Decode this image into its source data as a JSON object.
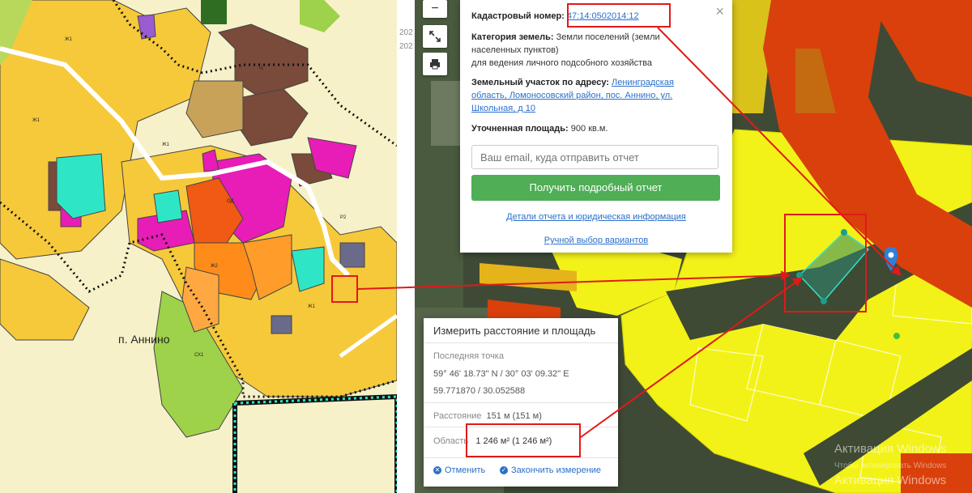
{
  "left_map": {
    "settlement_label": "п. Аннино"
  },
  "right_map": {
    "year_tabs": [
      "202",
      "202"
    ],
    "controls": {
      "zoom_out": "−",
      "fullscreen_icon": "expand-icon",
      "print_icon": "printer-icon"
    }
  },
  "info_popup": {
    "close": "×",
    "cadastral_label": "Кадастровый номер:",
    "cadastral_value": "47:14:0502014:12",
    "category_label": "Категория земель:",
    "category_value": "Земли поселений (земли населенных пунктов)",
    "usage_value": "для ведения личного подсобного хозяйства",
    "address_label": "Земельный участок по адресу:",
    "address_value": "Ленинградская область, Ломоносовский район, пос. Аннино, ул. Школьная, д 10",
    "area_label": "Уточненная площадь:",
    "area_value": "900 кв.м.",
    "email_placeholder": "Ваш email, куда отправить отчет",
    "report_button": "Получить подробный отчет",
    "details_link": "Детали отчета и юридическая информация",
    "manual_link": "Ручной выбор вариантов"
  },
  "measure_popup": {
    "title": "Измерить расстояние и площадь",
    "last_point_label": "Последняя точка",
    "coords_dms": "59° 46' 18.73\" N / 30° 03' 09.32\" E",
    "coords_decimal": "59.771870 / 30.052588",
    "distance_label": "Расстояние",
    "distance_value": "151 м (151 м)",
    "area_label": "Область",
    "area_value": "1 246 м² (1 246 м²)",
    "cancel": "Отменить",
    "finish": "Закончить измерение"
  },
  "watermark": {
    "title": "Активация Windows",
    "subtitle": "Чтобы активировать Windows",
    "title_repeat": "Активация Windows"
  },
  "colors": {
    "annotation_red": "#e01a1a",
    "report_green": "#4fae56",
    "link_blue": "#2a6fc9"
  }
}
